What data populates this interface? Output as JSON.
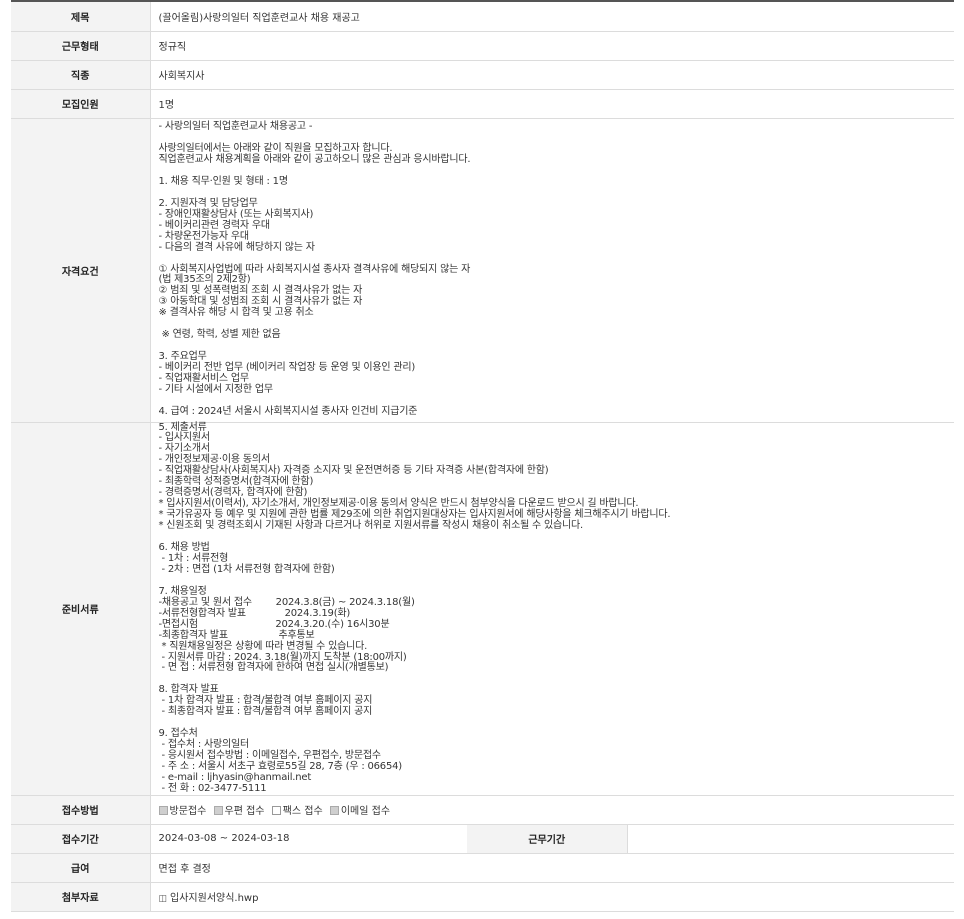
{
  "rows": {
    "title": {
      "label": "제목",
      "value": "(끌어올림)사랑의일터 직업훈련교사 채용 재공고"
    },
    "work_type": {
      "label": "근무형태",
      "value": "정규직"
    },
    "occupation": {
      "label": "직종",
      "value": "사회복지사"
    },
    "headcount": {
      "label": "모집인원",
      "value": "1명"
    },
    "qualification": {
      "label": "자격요건",
      "lines": [
        "- 사랑의일터 직업훈련교사 채용공고 -",
        "",
        "사랑의일터에서는 아래와 같이 직원을 모집하고자 합니다.",
        "직업훈련교사 채용계획을 아래와 같이 공고하오니 많은 관심과 응시바랍니다.",
        "",
        "1. 채용 직무·인원 및 형태 : 1명",
        "",
        "2. 지원자격 및 담당업무",
        "- 장애인재활상담사 (또는 사회복지사)",
        "- 베이커리관련 경력자 우대",
        "- 차량운전가능자 우대",
        "- 다음의 결격 사유에 해당하지 않는 자",
        "",
        "① 사회복지사업법에 따라 사회복지시설 종사자 결격사유에 해당되지 않는 자",
        "(법 제35조의 2제2항)",
        "② 범죄 및 성폭력범죄 조회 시 결격사유가 없는 자",
        "③ 아동학대 및 성범죄 조회 시 결격사유가 없는 자",
        "※ 결격사유 해당 시 합격 및 고용 취소",
        "",
        " ※ 연령, 학력, 성별 제한 없음",
        "",
        "3. 주요업무",
        "- 베이커리 전반 업무 (베이커리 작업장 등 운영 및 이용인 관리)",
        "- 직업재활서비스 업무",
        "- 기타 시설에서 지정한 업무",
        "",
        "4. 급여 : 2024년 서울시 사회복지시설 종사자 인건비 지급기준"
      ]
    },
    "documents": {
      "label": "준비서류",
      "lines": [
        "5. 제출서류",
        "- 입사지원서",
        "- 자기소개서",
        "- 개인정보제공·이용 동의서",
        "- 직업재활상담사(사회복지사) 자격증 소지자 및 운전면허증 등 기타 자격증 사본(합격자에 한함)",
        "- 최종학력 성적증명서(합격자에 한함)",
        "- 경력증명서(경력자, 합격자에 한함)",
        "* 입사지원서(이력서), 자기소개서, 개인정보제공·이용 동의서 양식은 반드시 첨부양식을 다운로드 받으시 길 바랍니다.",
        "* 국가유공자 등 예우 및 지원에 관한 법률 제29조에 의한 취업지원대상자는 입사지원서에 해당사항을 체크해주시기 바랍니다.",
        "* 신원조회 및 경력조회시 기재된 사항과 다르거나 허위로 지원서류를 작성시 채용이 취소될 수 있습니다.",
        "",
        "6. 채용 방법",
        " - 1차 : 서류전형",
        " - 2차 : 면접 (1차 서류전형 합격자에 한함)",
        "",
        "7. 채용일정",
        "-채용공고 및 원서 접수        2024.3.8(금) ~ 2024.3.18(월)",
        "-서류전형합격자 발표             2024.3.19(화)",
        "-면접시험                          2024.3.20.(수) 16시30분",
        "-최종합격자 발표                 추후통보",
        " * 직원채용일정은 상황에 따라 변경될 수 있습니다.",
        " - 지원서류 마감 : 2024. 3.18(월)까지 도착분 (18:00까지)",
        " - 면 접 : 서류전형 합격자에 한하여 면접 실시(개별통보)",
        "",
        "8. 합격자 발표",
        " - 1차 합격자 발표 : 합격/불합격 여부 홈페이지 공지",
        " - 최종합격자 발표 : 합격/불합격 여부 홈페이지 공지",
        "",
        "9. 접수처",
        " - 접수처 : 사랑의일터",
        " - 응시원서 접수방법 : 이메일접수, 우편접수, 방문접수",
        " - 주 소 : 서울시 서초구 효령로55길 28, 7층 (우 : 06654)",
        " - e-mail : ljhyasin@hanmail.net",
        " - 전 화 : 02-3477-5111"
      ]
    },
    "method": {
      "label": "접수방법",
      "options": [
        {
          "label": "방문접수",
          "checked": true
        },
        {
          "label": "우편 접수",
          "checked": true
        },
        {
          "label": "팩스 접수",
          "checked": false
        },
        {
          "label": "이메일 접수",
          "checked": true
        }
      ]
    },
    "period": {
      "label": "접수기간",
      "value": "2024-03-08 ~ 2024-03-18",
      "work_period_label": "근무기간",
      "work_period_value": ""
    },
    "salary": {
      "label": "급여",
      "value": "면접 후 결정"
    },
    "attachment": {
      "label": "첨부자료",
      "file": "입사지원서양식.hwp"
    }
  }
}
